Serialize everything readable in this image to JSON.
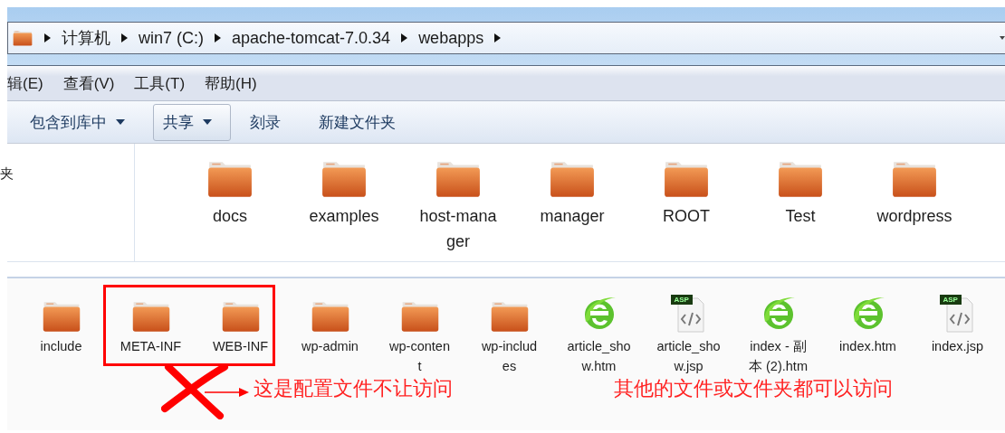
{
  "address_bar": {
    "crumbs": [
      "计算机",
      "win7 (C:)",
      "apache-tomcat-7.0.34",
      "webapps"
    ]
  },
  "menu_bar": [
    "辑(E)",
    "查看(V)",
    "工具(T)",
    "帮助(H)"
  ],
  "toolbar": [
    {
      "label": "包含到库中",
      "dropdown": true,
      "selected": false
    },
    {
      "label": "共享",
      "dropdown": true,
      "selected": true
    },
    {
      "label": "刻录",
      "dropdown": false,
      "selected": false
    },
    {
      "label": "新建文件夹",
      "dropdown": false,
      "selected": false
    }
  ],
  "sidebar": {
    "text": "夹"
  },
  "folders": [
    {
      "label_lines": [
        "docs"
      ]
    },
    {
      "label_lines": [
        "examples"
      ]
    },
    {
      "label_lines": [
        "host-mana",
        "ger"
      ]
    },
    {
      "label_lines": [
        "manager"
      ]
    },
    {
      "label_lines": [
        "ROOT"
      ]
    },
    {
      "label_lines": [
        "Test"
      ]
    },
    {
      "label_lines": [
        "wordpress"
      ]
    }
  ],
  "files": [
    {
      "kind": "folder",
      "label_lines": [
        "include"
      ]
    },
    {
      "kind": "folder",
      "label_lines": [
        "META-INF"
      ]
    },
    {
      "kind": "folder",
      "label_lines": [
        "WEB-INF"
      ]
    },
    {
      "kind": "folder",
      "label_lines": [
        "wp-admin"
      ]
    },
    {
      "kind": "folder",
      "label_lines": [
        "wp-conten",
        "t"
      ]
    },
    {
      "kind": "folder",
      "label_lines": [
        "wp-includ",
        "es"
      ]
    },
    {
      "kind": "html",
      "label_lines": [
        "article_sho",
        "w.htm"
      ]
    },
    {
      "kind": "jsp",
      "badge": "ASP",
      "label_lines": [
        "article_sho",
        "w.jsp"
      ]
    },
    {
      "kind": "html",
      "label_lines": [
        "index - 副",
        "本 (2).htm"
      ]
    },
    {
      "kind": "html",
      "label_lines": [
        "index.htm"
      ]
    },
    {
      "kind": "jsp",
      "badge": "ASP",
      "label_lines": [
        "index.jsp"
      ]
    }
  ],
  "annotations": [
    {
      "kind": "crossed",
      "text": "这是配置文件不让访问"
    },
    {
      "kind": "plain",
      "text": "其他的文件或文件夹都可以访问"
    }
  ]
}
